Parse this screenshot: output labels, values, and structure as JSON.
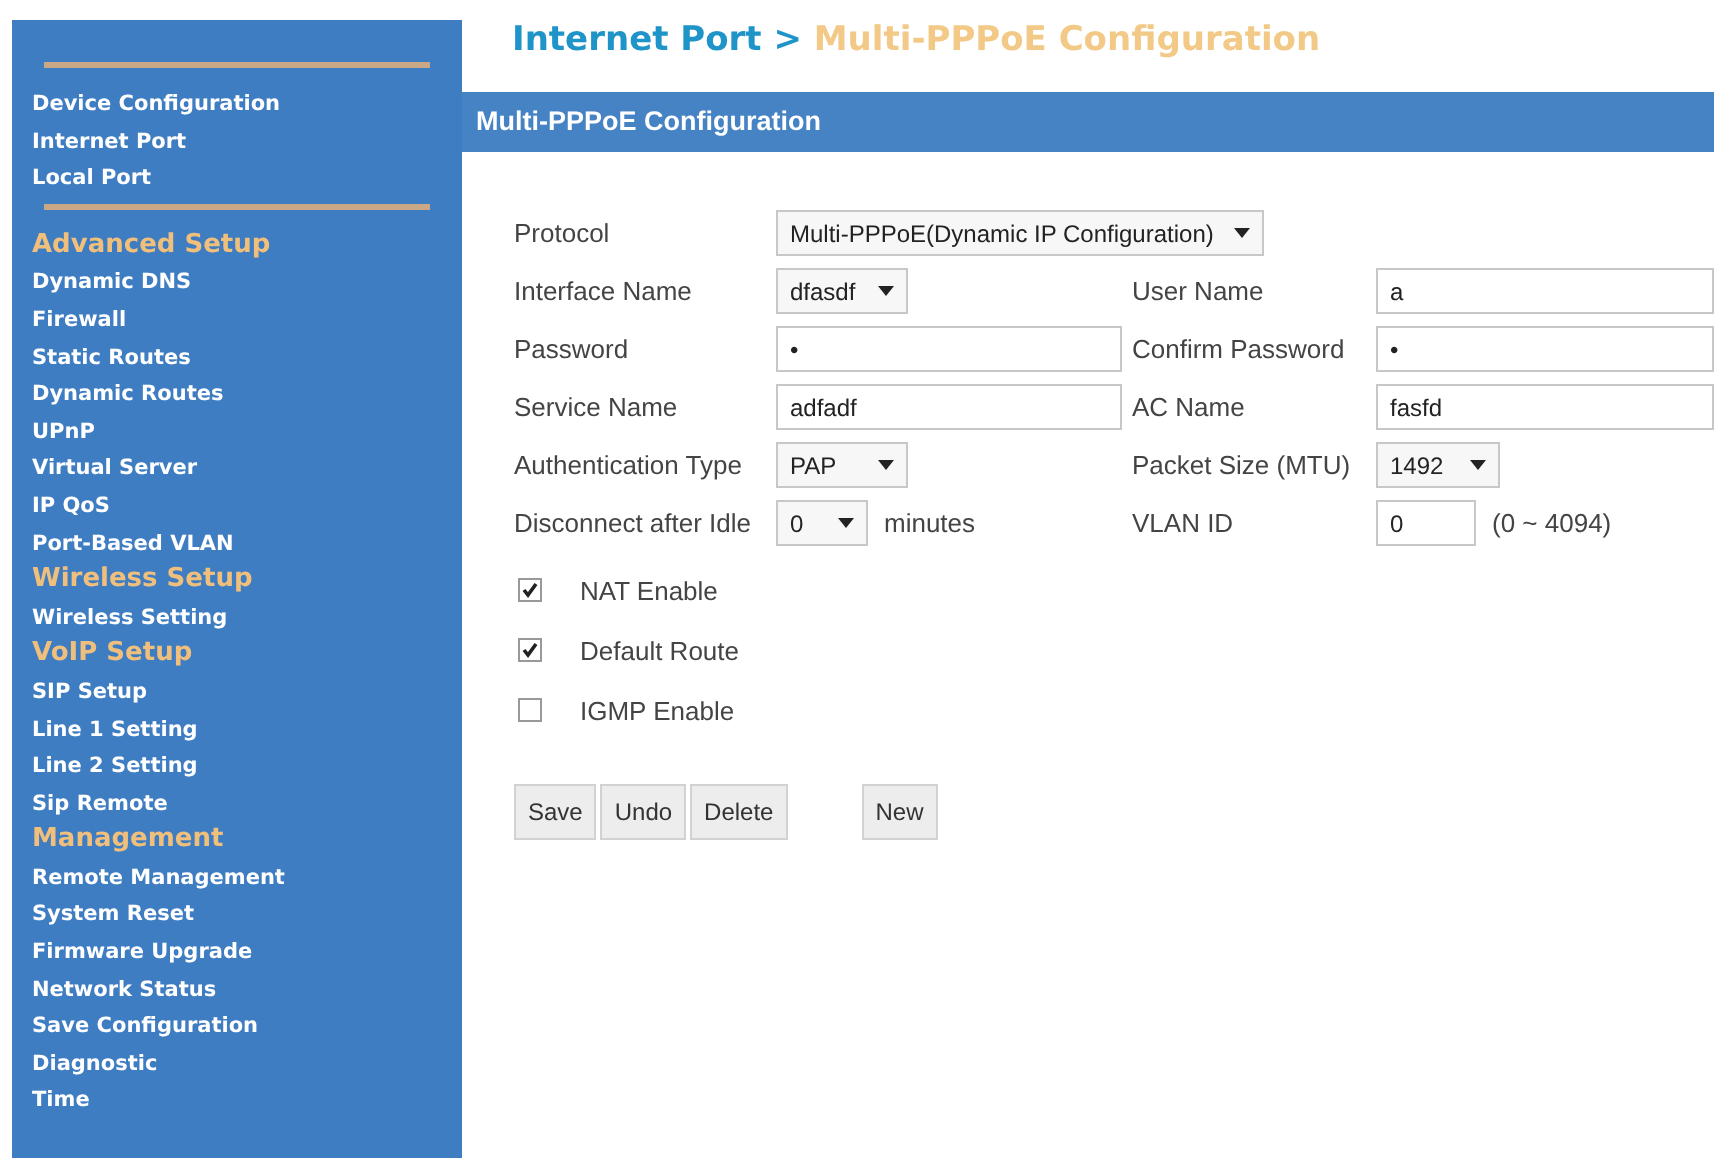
{
  "sidebar": {
    "entries": [
      {
        "kind": "rule"
      },
      {
        "kind": "item",
        "label": "Device Configuration"
      },
      {
        "kind": "item",
        "label": "Internet Port"
      },
      {
        "kind": "item",
        "label": "Local Port"
      },
      {
        "kind": "rule"
      },
      {
        "kind": "heading",
        "label": "Advanced Setup"
      },
      {
        "kind": "item",
        "label": "Dynamic DNS"
      },
      {
        "kind": "item",
        "label": "Firewall"
      },
      {
        "kind": "item",
        "label": "Static Routes"
      },
      {
        "kind": "item",
        "label": "Dynamic Routes"
      },
      {
        "kind": "item",
        "label": "UPnP"
      },
      {
        "kind": "item",
        "label": "Virtual Server"
      },
      {
        "kind": "item",
        "label": "IP QoS"
      },
      {
        "kind": "item",
        "label": "Port-Based VLAN"
      },
      {
        "kind": "heading",
        "label": "Wireless Setup"
      },
      {
        "kind": "item",
        "label": "Wireless Setting"
      },
      {
        "kind": "heading",
        "label": "VoIP Setup"
      },
      {
        "kind": "item",
        "label": "SIP Setup"
      },
      {
        "kind": "item",
        "label": "Line 1 Setting"
      },
      {
        "kind": "item",
        "label": "Line 2 Setting"
      },
      {
        "kind": "item",
        "label": "Sip Remote"
      },
      {
        "kind": "heading",
        "label": "Management"
      },
      {
        "kind": "item",
        "label": "Remote Management"
      },
      {
        "kind": "item",
        "label": "System Reset"
      },
      {
        "kind": "item",
        "label": "Firmware Upgrade"
      },
      {
        "kind": "item",
        "label": "Network Status"
      },
      {
        "kind": "item",
        "label": "Save Configuration"
      },
      {
        "kind": "item",
        "label": "Diagnostic"
      },
      {
        "kind": "item",
        "label": "Time"
      }
    ]
  },
  "breadcrumb": {
    "parent": "Internet Port",
    "separator": ">",
    "current": "Multi-PPPoE Configuration"
  },
  "panel": {
    "title": "Multi-PPPoE Configuration",
    "rows": [
      [
        {
          "label": "Protocol",
          "kind": "select",
          "value": "Multi-PPPoE(Dynamic IP Configuration)"
        }
      ],
      [
        {
          "label": "Interface Name",
          "kind": "select",
          "value": "dfasdf"
        },
        {
          "label": "User Name",
          "kind": "input",
          "value": "a"
        }
      ],
      [
        {
          "label": "Password",
          "kind": "input",
          "value": "•"
        },
        {
          "label": "Confirm Password",
          "kind": "input",
          "value": "•"
        }
      ],
      [
        {
          "label": "Service Name",
          "kind": "input",
          "value": "adfadf"
        },
        {
          "label": "AC Name",
          "kind": "input",
          "value": "fasfd"
        }
      ],
      [
        {
          "label": "Authentication Type",
          "kind": "select",
          "value": "PAP"
        },
        {
          "label": "Packet Size (MTU)",
          "kind": "select",
          "value": "1492"
        }
      ],
      [
        {
          "label": "Disconnect after Idle",
          "kind": "select",
          "value": "0",
          "suffix": "minutes"
        },
        {
          "label": "VLAN ID",
          "kind": "input",
          "value": "0",
          "suffix": "(0 ~ 4094)"
        }
      ]
    ],
    "checkboxes": [
      {
        "label": "NAT Enable",
        "checked": true
      },
      {
        "label": "Default Route",
        "checked": true
      },
      {
        "label": "IGMP Enable",
        "checked": false
      }
    ],
    "buttons": [
      {
        "label": "Save"
      },
      {
        "label": "Undo"
      },
      {
        "label": "Delete"
      },
      {
        "label": "New"
      }
    ]
  }
}
